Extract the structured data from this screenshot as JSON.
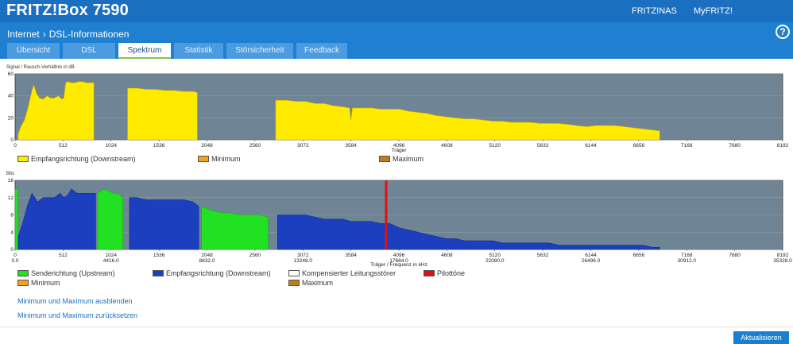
{
  "header": {
    "brand": "FRITZ!Box 7590",
    "links": [
      "FRITZ!NAS",
      "MyFRITZ!"
    ]
  },
  "nav": {
    "breadcrumb": [
      "Internet",
      "DSL-Informationen"
    ],
    "help": "?",
    "tabs": [
      "Übersicht",
      "DSL",
      "Spektrum",
      "Statistik",
      "Störsicherheit",
      "Feedback"
    ],
    "active_tab": "Spektrum"
  },
  "chart1": {
    "ylabel": "Signal / Rausch-Verhältnis in dB",
    "xlabel": "Träger",
    "yticks": [
      "60",
      "40",
      "20",
      "0"
    ],
    "xticks": [
      "0",
      "512",
      "1024",
      "1536",
      "2048",
      "2560",
      "3072",
      "3584",
      "4096",
      "4608",
      "5120",
      "5632",
      "6144",
      "6656",
      "7168",
      "7680",
      "8192"
    ],
    "legend": [
      {
        "label": "Empfangsrichtung (Downstream)",
        "color": "#ffeb00"
      },
      {
        "label": "Minimum",
        "color": "#f5a21b"
      },
      {
        "label": "Maximum",
        "color": "#c47a1a"
      }
    ]
  },
  "chart2": {
    "ylabel": "Bits",
    "xlabel": "Träger / Frequenz in kHz",
    "yticks": [
      "16",
      "12",
      "8",
      "4",
      "0"
    ],
    "xticks": [
      "0",
      "512",
      "1024",
      "1536",
      "2048",
      "2560",
      "3072",
      "3584",
      "4096",
      "4608",
      "5120",
      "5632",
      "6144",
      "6656",
      "7168",
      "7680",
      "8192"
    ],
    "freq_ticks": [
      "0.0",
      "4416.0",
      "8832.0",
      "13248.0",
      "17664.0",
      "22080.0",
      "26496.0",
      "30912.0",
      "35328.0"
    ],
    "legend": [
      {
        "label": "Senderichtung (Upstream)",
        "color": "#22e022"
      },
      {
        "label": "Empfangsrichtung (Downstream)",
        "color": "#1c3fbf"
      },
      {
        "label": "Kompensierter Leitungsstörer",
        "color": "#ffffff"
      },
      {
        "label": "Pilottöne",
        "color": "#e01010"
      },
      {
        "label": "Minimum",
        "color": "#f5a21b"
      },
      {
        "label": "Maximum",
        "color": "#c47a1a"
      }
    ]
  },
  "chart_data": [
    {
      "type": "area",
      "ylabel": "Signal / Rausch-Verhältnis in dB",
      "xlabel": "Träger",
      "xlim": [
        0,
        8192
      ],
      "ylim": [
        0,
        60
      ],
      "grid": true,
      "series": [
        {
          "name": "Empfangsrichtung (Downstream)",
          "segments": [
            {
              "x": [
                32,
                60,
                100,
                140,
                180,
                200,
                230,
                260,
                300,
                340,
                380,
                420,
                460,
                500,
                520,
                540,
                560,
                600,
                640,
                680,
                720,
                760,
                800,
                840
              ],
              "y": [
                5,
                12,
                18,
                30,
                45,
                50,
                42,
                38,
                37,
                40,
                38,
                38,
                40,
                37,
                38,
                52,
                53,
                52,
                52,
                53,
                53,
                52,
                52,
                52
              ]
            },
            {
              "x": [
                1200,
                1300,
                1400,
                1500,
                1600,
                1700,
                1800,
                1900,
                1945
              ],
              "y": [
                47,
                47,
                46,
                46,
                45,
                45,
                44,
                44,
                43
              ]
            },
            {
              "x": [
                2780,
                2900,
                3000,
                3100,
                3200,
                3300,
                3400,
                3500,
                3570,
                3584,
                3600,
                3700,
                3800,
                3900,
                4000,
                4100,
                4200,
                4300,
                4400,
                4500,
                4600,
                4700,
                4800,
                4900,
                5000,
                5100,
                5200,
                5300,
                5400,
                5500,
                5600,
                5700,
                5800,
                5900,
                6000,
                6100,
                6200,
                6300,
                6400,
                6500,
                6600,
                6700,
                6800,
                6880
              ],
              "y": [
                36,
                36,
                35,
                35,
                33,
                33,
                31,
                30,
                29,
                18,
                29,
                29,
                29,
                28,
                28,
                28,
                26,
                25,
                24,
                22,
                21,
                20,
                19,
                19,
                18,
                17,
                17,
                16,
                16,
                16,
                15,
                15,
                15,
                14,
                13,
                12,
                13,
                13,
                13,
                12,
                11,
                10,
                9,
                8
              ]
            }
          ]
        }
      ]
    },
    {
      "type": "area",
      "ylabel": "Bits",
      "xlabel": "Träger / Frequenz in kHz",
      "xlim": [
        0,
        8192
      ],
      "ylim": [
        0,
        16
      ],
      "grid": true,
      "series": [
        {
          "name": "Senderichtung (Upstream)",
          "segments": [
            {
              "x": [
                0,
                32
              ],
              "y": [
                14,
                14
              ]
            },
            {
              "x": [
                880,
                950,
                1000,
                1050,
                1100,
                1150
              ],
              "y": [
                13,
                14,
                13.5,
                13,
                13,
                12
              ]
            },
            {
              "x": [
                1990,
                2050,
                2100,
                2200,
                2300,
                2400,
                2500,
                2600,
                2700
              ],
              "y": [
                10,
                9.5,
                9,
                8.5,
                8.5,
                8,
                8,
                8,
                7.5
              ]
            }
          ]
        },
        {
          "name": "Empfangsrichtung (Downstream)",
          "segments": [
            {
              "x": [
                32,
                80,
                130,
                180,
                240,
                300,
                360,
                420,
                480,
                520,
                560,
                600,
                660,
                720,
                760,
                820,
                860
              ],
              "y": [
                3,
                6,
                10,
                13,
                11,
                12,
                12,
                12,
                13,
                12,
                12.5,
                14,
                13,
                13,
                13,
                13,
                13
              ]
            },
            {
              "x": [
                1220,
                1300,
                1400,
                1500,
                1600,
                1700,
                1800,
                1900,
                1960
              ],
              "y": [
                12,
                12,
                11.5,
                11.5,
                11.5,
                11.5,
                11.5,
                11,
                10
              ]
            },
            {
              "x": [
                2800,
                2900,
                3000,
                3100,
                3200,
                3300,
                3400,
                3500,
                3584,
                3700,
                3800,
                3900,
                4000,
                4100,
                4200,
                4300,
                4400,
                4500,
                4600,
                4700,
                4800,
                4900,
                5000,
                5100,
                5200,
                5300,
                5400,
                5500,
                5600,
                5700,
                5800,
                5900,
                6000,
                6100,
                6200,
                6300,
                6400,
                6500,
                6600,
                6700,
                6800,
                6880
              ],
              "y": [
                8,
                8,
                8,
                8,
                7.5,
                7,
                7,
                7,
                6.5,
                6.5,
                6.5,
                6,
                6,
                5,
                4.5,
                4,
                3.5,
                3,
                2.5,
                2.5,
                2,
                2,
                2,
                2,
                1.5,
                1.5,
                1.5,
                1.5,
                1.5,
                1.5,
                1,
                1,
                1,
                1,
                1,
                1,
                1,
                1,
                1,
                1,
                0.5,
                0.5
              ]
            }
          ]
        },
        {
          "name": "Pilottöne",
          "markers_x": [
            3960
          ]
        }
      ]
    }
  ],
  "actions": {
    "hide_minmax": "Minimum und Maximum ausblenden",
    "reset_minmax": "Minimum und Maximum zurücksetzen",
    "refresh": "Aktualisieren"
  }
}
